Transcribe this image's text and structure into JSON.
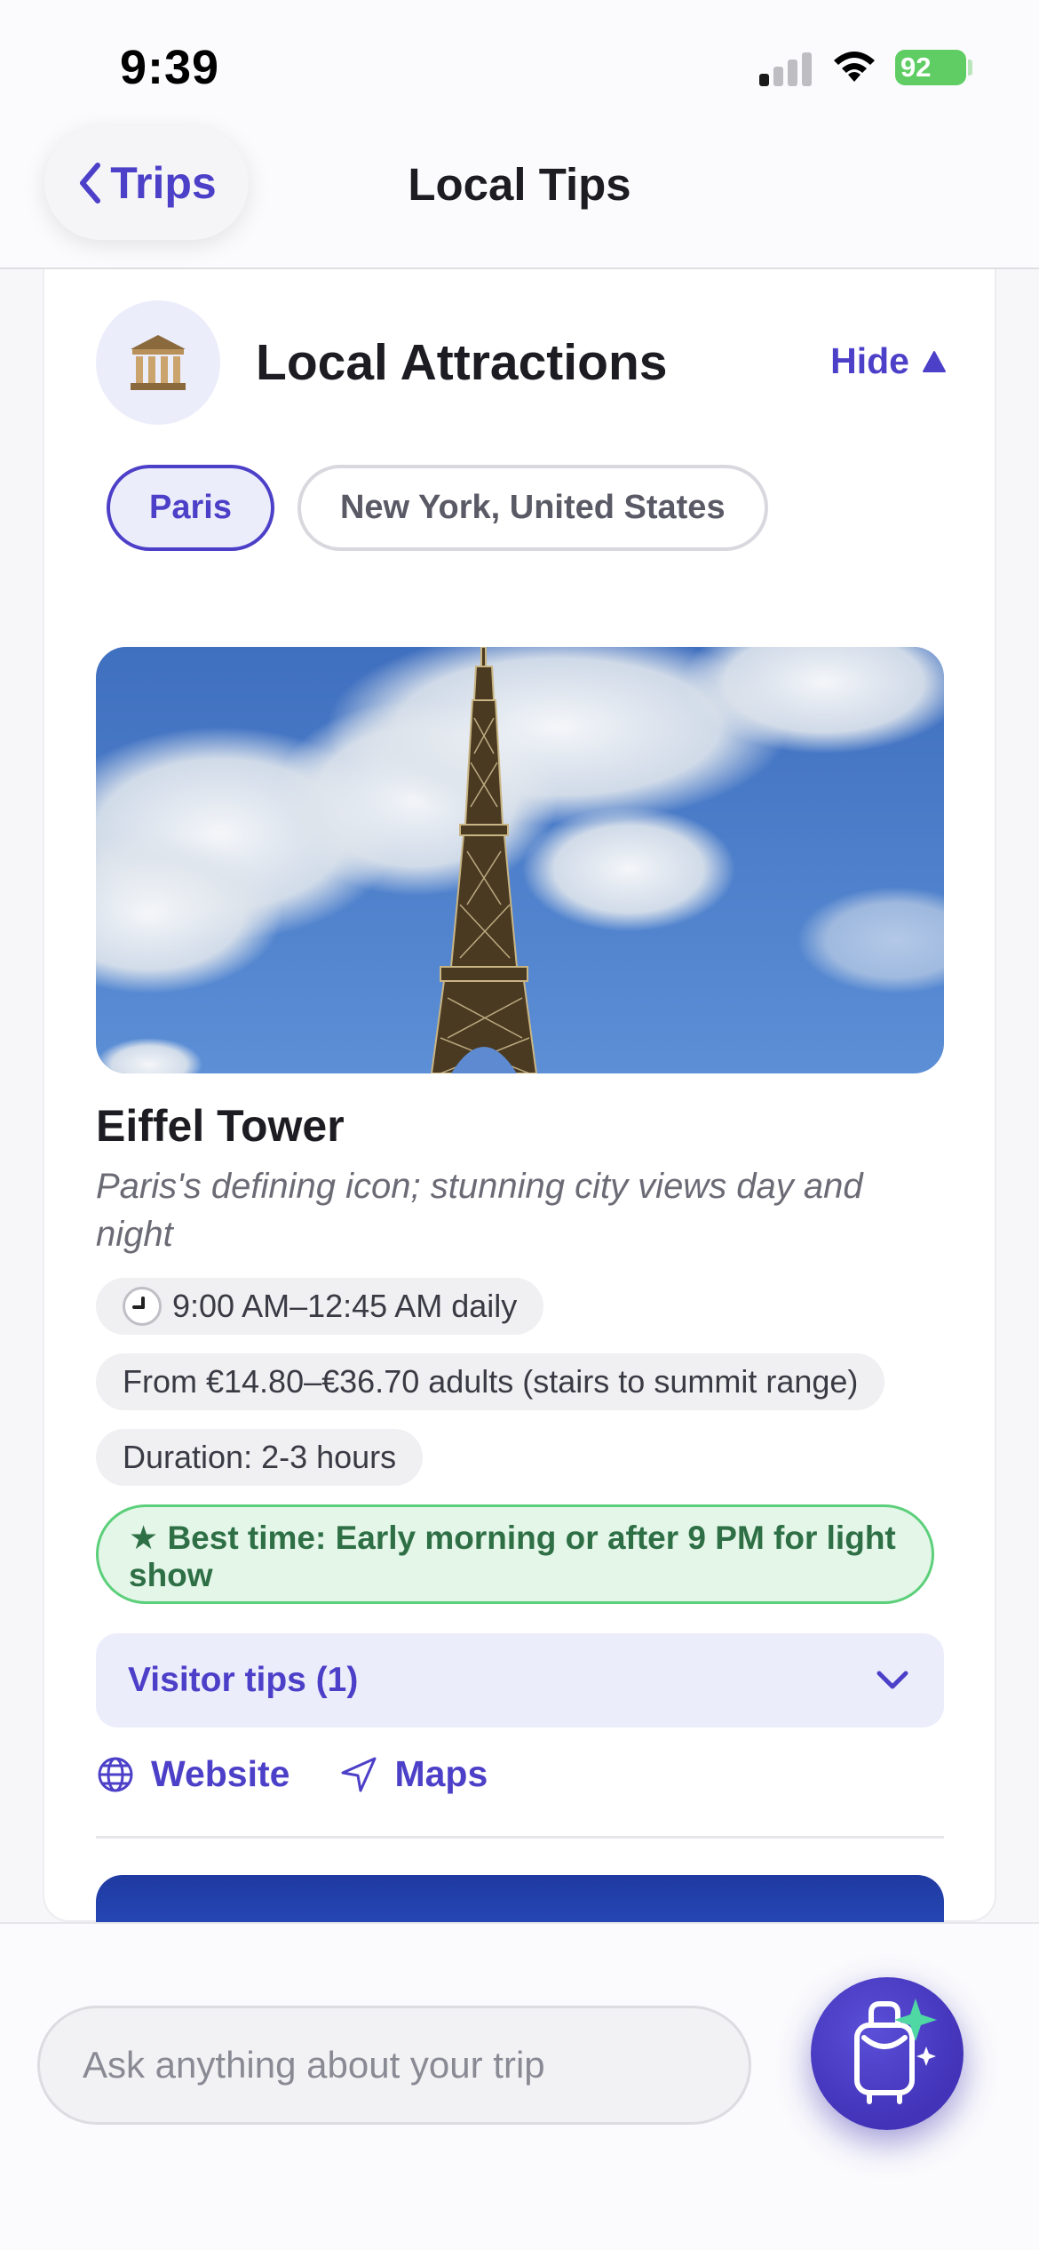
{
  "status_bar": {
    "time": "9:39",
    "battery": "92"
  },
  "nav": {
    "back_label": "Trips",
    "title": "Local Tips"
  },
  "section": {
    "title": "Local Attractions",
    "hide_label": "Hide",
    "chips": [
      {
        "label": "Paris",
        "active": true
      },
      {
        "label": "New York, United States",
        "active": false
      }
    ]
  },
  "attraction": {
    "name": "Eiffel Tower",
    "description": "Paris's defining icon; stunning city views day and night",
    "hours": "9:00 AM–12:45 AM daily",
    "price": "From €14.80–€36.70 adults (stairs to summit range)",
    "duration": "Duration: 2-3 hours",
    "best_time": "★ Best time: Early morning or after 9 PM for light show",
    "visitor_tips_label": "Visitor tips (1)",
    "website_label": "Website",
    "maps_label": "Maps"
  },
  "chat": {
    "placeholder": "Ask anything about your trip"
  },
  "colors": {
    "accent": "#4d40c8",
    "accent_bg": "#ecedfb",
    "success": "#2e6f45",
    "success_bg": "#e3f6e8"
  }
}
